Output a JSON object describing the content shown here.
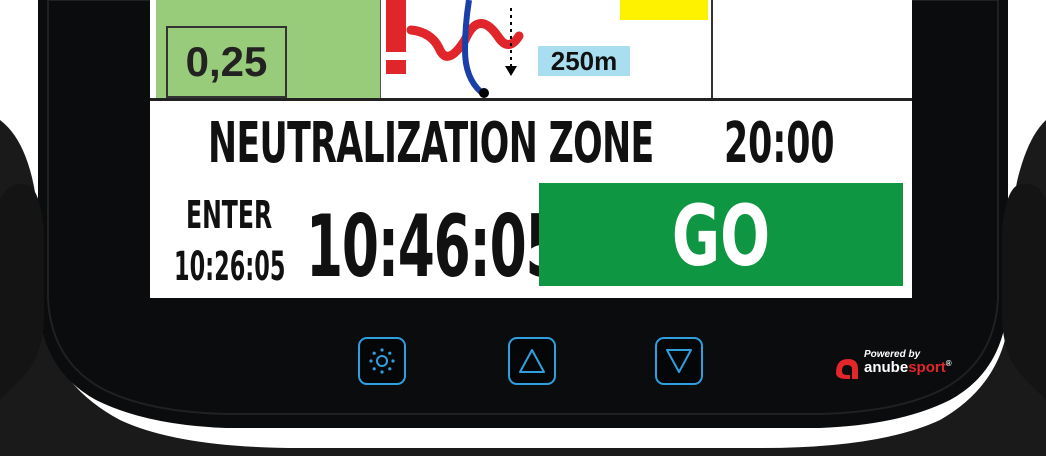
{
  "roadbook": {
    "distance_value": "0,25",
    "distance_badge": "250m"
  },
  "zone": {
    "title": "NEUTRALIZATION ZONE",
    "duration": "20:00"
  },
  "enter": {
    "label": "ENTER",
    "time": "10:26:05"
  },
  "clock": "10:46:05",
  "go_button": {
    "label": "GO",
    "color": "#0f9642"
  },
  "hardware_buttons": [
    {
      "name": "brightness",
      "icon": "sun-icon"
    },
    {
      "name": "up",
      "icon": "triangle-up-icon"
    },
    {
      "name": "down",
      "icon": "triangle-down-icon"
    }
  ],
  "brand": {
    "powered_by": "Powered by",
    "name_part1": "anube",
    "name_part2": "sport",
    "registered": "®",
    "accent_color": "#e3262a",
    "button_color": "#2f9fe0"
  }
}
